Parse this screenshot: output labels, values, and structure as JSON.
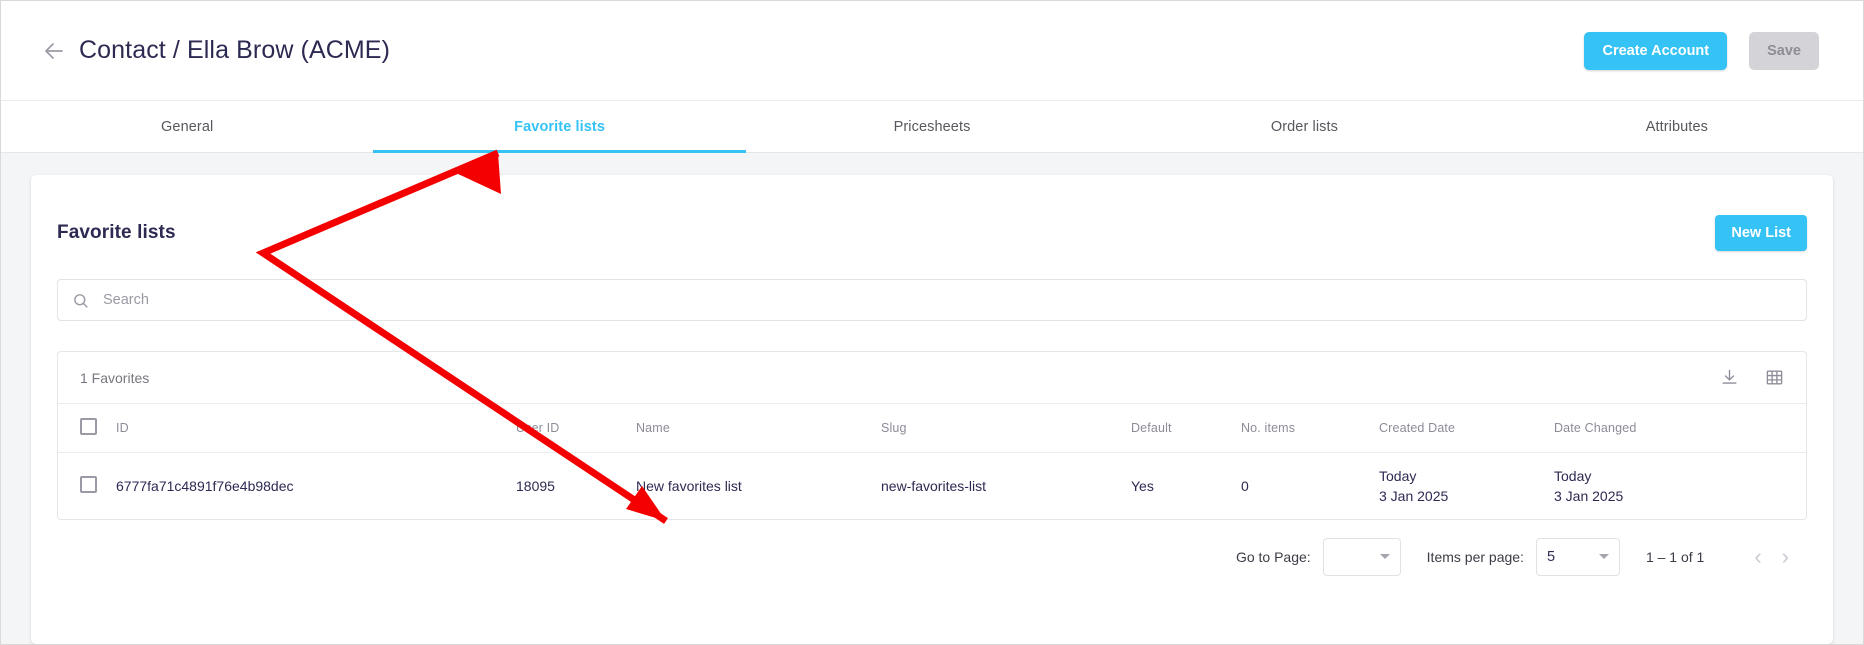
{
  "header": {
    "back_icon": "arrow-left-icon",
    "title": "Contact / Ella Brow (ACME)",
    "create_account_label": "Create Account",
    "save_label": "Save",
    "accent_color": "#35c2f4",
    "title_color": "#2d2a52"
  },
  "tabs": [
    {
      "label": "General",
      "active": false
    },
    {
      "label": "Favorite lists",
      "active": true
    },
    {
      "label": "Pricesheets",
      "active": false
    },
    {
      "label": "Order lists",
      "active": false
    },
    {
      "label": "Attributes",
      "active": false
    }
  ],
  "card": {
    "title": "Favorite lists",
    "new_list_label": "New List"
  },
  "search": {
    "placeholder": "Search",
    "value": "",
    "icon": "search-icon"
  },
  "table": {
    "count_label": "1 Favorites",
    "download_icon": "download-icon",
    "columns_icon": "grid-icon",
    "columns": [
      "ID",
      "User ID",
      "Name",
      "Slug",
      "Default",
      "No. items",
      "Created Date",
      "Date Changed"
    ],
    "rows": [
      {
        "id": "6777fa71c4891f76e4b98dec",
        "user_id": "18095",
        "name": "New favorites list",
        "slug": "new-favorites-list",
        "default": "Yes",
        "no_items": "0",
        "created_date_relative": "Today",
        "created_date_absolute": "3 Jan 2025",
        "changed_date_relative": "Today",
        "changed_date_absolute": "3 Jan 2025"
      }
    ]
  },
  "pagination": {
    "goto_page_label": "Go to Page:",
    "goto_page_value": "",
    "items_per_page_label": "Items per page:",
    "items_per_page_value": "5",
    "range_label": "1 – 1 of 1",
    "prev_icon": "chevron-left-icon",
    "next_icon": "chevron-right-icon"
  },
  "annotation": {
    "color": "#f50000",
    "description": "red-pointer-arrow"
  }
}
